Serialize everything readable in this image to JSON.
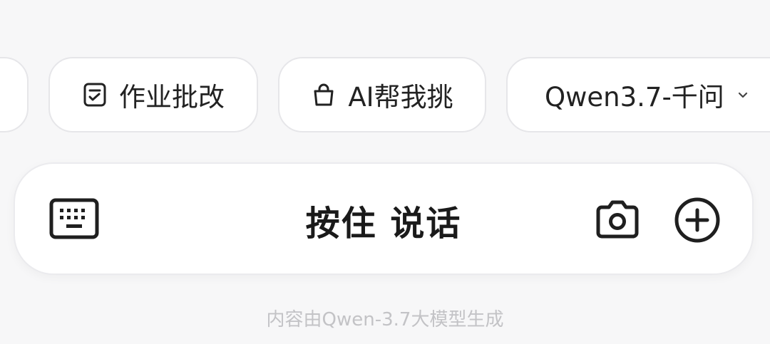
{
  "chips": {
    "homework": {
      "label": "作业批改",
      "icon": "homework-check-icon"
    },
    "ai_pick": {
      "label": "AI帮我挑",
      "icon": "shopping-bag-icon"
    },
    "model": {
      "label": "Qwen3.7-千问",
      "icon": "chevron-down-icon"
    }
  },
  "input_bar": {
    "keyboard_icon": "keyboard-icon",
    "hold_to_talk_label": "按住 说话",
    "camera_icon": "camera-icon",
    "add_icon": "plus-circle-icon"
  },
  "footer": {
    "disclaimer": "内容由Qwen-3.7大模型生成"
  },
  "colors": {
    "background": "#f7f7f8",
    "chip_border": "#e6e6e9",
    "text_primary": "#1f1f1f",
    "footer_text": "#c3c3c6"
  }
}
